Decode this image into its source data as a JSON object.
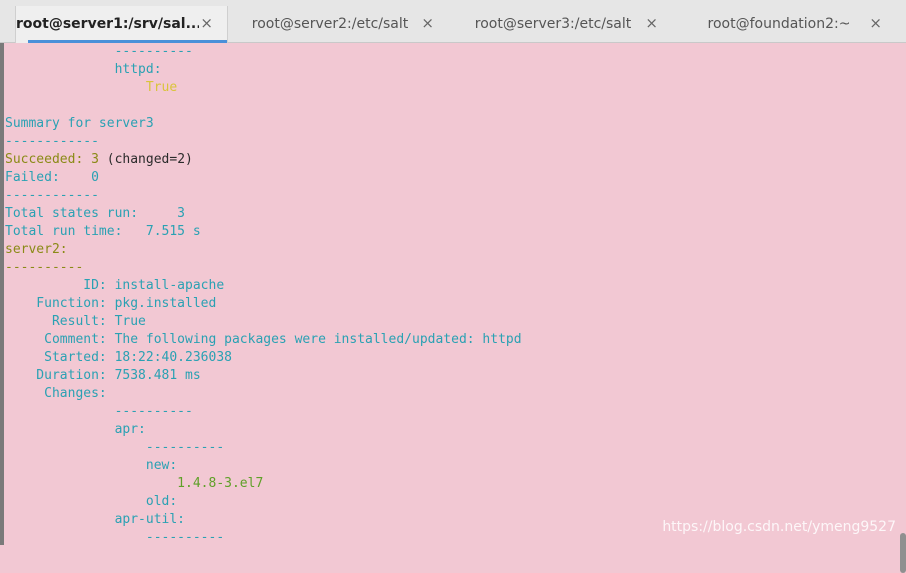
{
  "tabs": [
    {
      "label": "root@server1:/srv/sal..."
    },
    {
      "label": "root@server2:/etc/salt"
    },
    {
      "label": "root@server3:/etc/salt"
    },
    {
      "label": "root@foundation2:~"
    }
  ],
  "close_glyph": "×",
  "watermark": "https://blog.csdn.net/ymeng9527",
  "lines": {
    "l0": "              ----------",
    "l1": "              httpd:",
    "l2": "                  True",
    "l3": "",
    "l4": "Summary for server3",
    "l5": "------------",
    "l6a": "Succeeded: 3 ",
    "l6b": "(changed=2)",
    "l7": "Failed:    0",
    "l8": "------------",
    "l9": "Total states run:     3",
    "l10": "Total run time:   7.515 s",
    "l11": "server2:",
    "l12": "----------",
    "l13": "          ID: install-apache",
    "l14": "    Function: pkg.installed",
    "l15": "      Result: True",
    "l16": "     Comment: The following packages were installed/updated: httpd",
    "l17": "     Started: 18:22:40.236038",
    "l18": "    Duration: 7538.481 ms",
    "l19": "     Changes:",
    "l20": "              ----------",
    "l21": "              apr:",
    "l22": "                  ----------",
    "l23": "                  new:",
    "l24": "                      1.4.8-3.el7",
    "l25": "                  old:",
    "l26": "              apr-util:",
    "l27": "                  ----------"
  }
}
